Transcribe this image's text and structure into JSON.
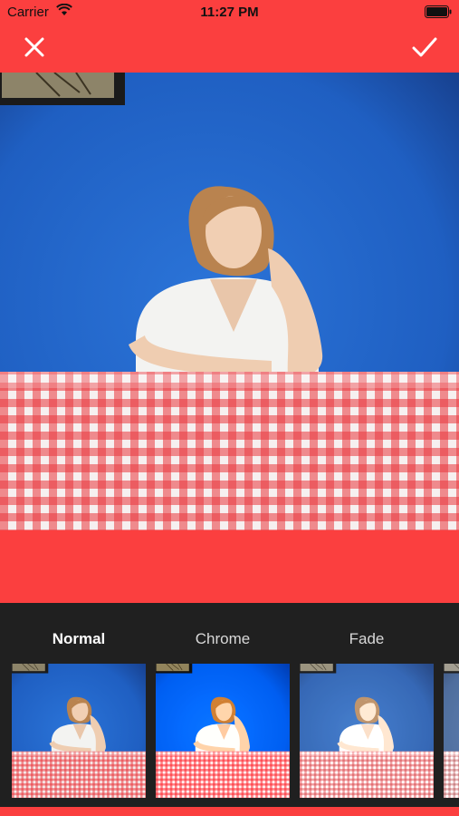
{
  "status_bar": {
    "carrier": "Carrier",
    "time": "11:27 PM",
    "icons": [
      "wifi-icon",
      "battery-icon"
    ]
  },
  "nav_bar": {
    "close_icon": "close-icon",
    "confirm_icon": "checkmark-icon"
  },
  "colors": {
    "accent": "#fb3f3f",
    "panel": "#202020",
    "wall": "#1f63c7",
    "tablecloth_red": "#e8373c"
  },
  "filters": {
    "selected": "Normal",
    "items": [
      {
        "label": "Normal"
      },
      {
        "label": "Chrome"
      },
      {
        "label": "Fade"
      },
      {
        "label": ""
      }
    ]
  }
}
